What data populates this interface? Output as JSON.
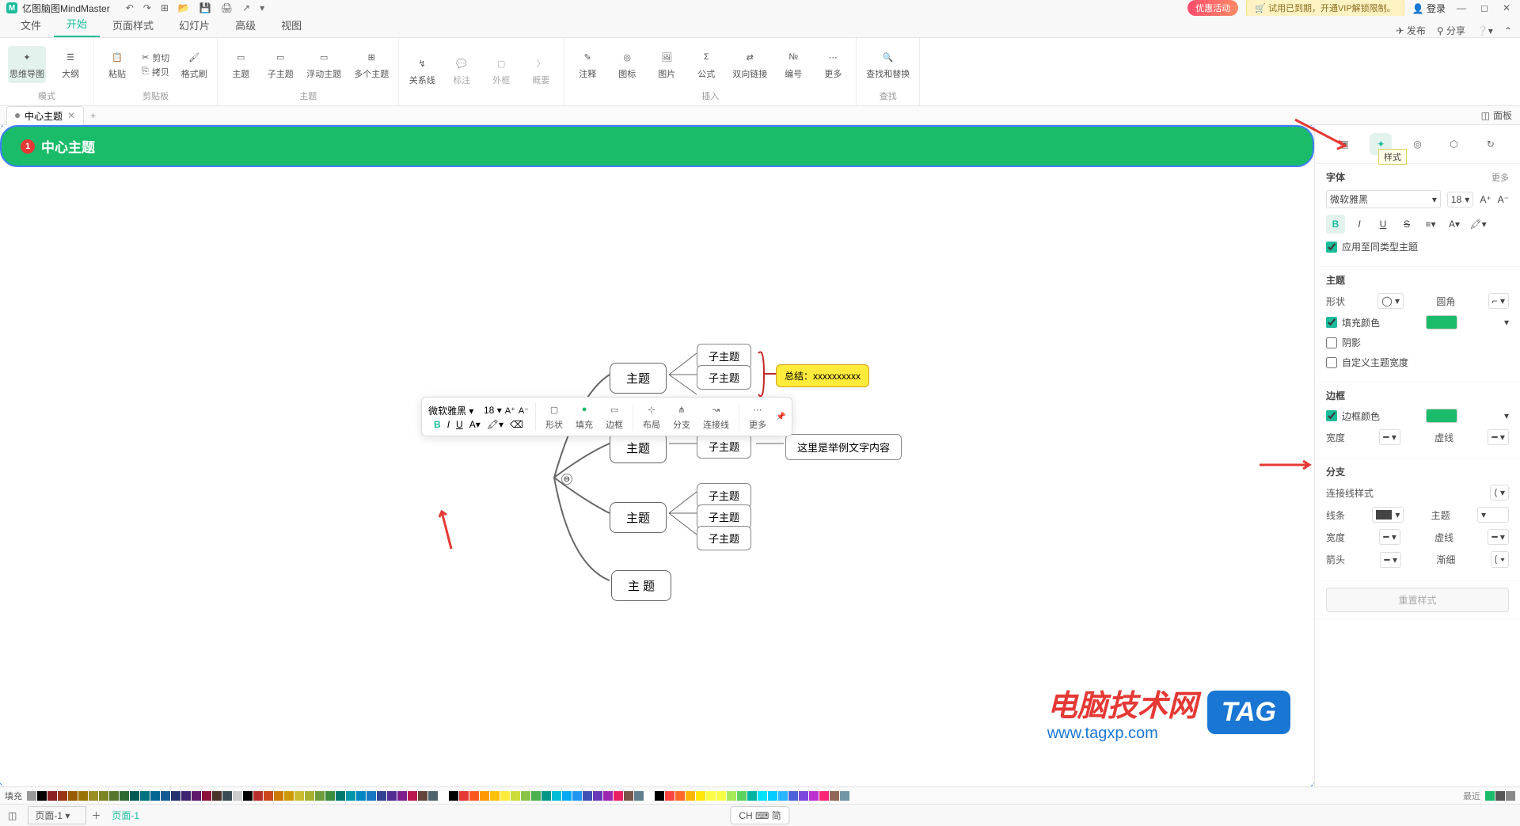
{
  "app": {
    "title": "亿图脑图MindMaster",
    "promo1": "优惠活动",
    "promo2": "🛒 试用已到期，开通VIP解锁限制。",
    "login": "👤 登录"
  },
  "menu": {
    "tabs": [
      "文件",
      "开始",
      "页面样式",
      "幻灯片",
      "高级",
      "视图"
    ],
    "active": 1,
    "publish": "发布",
    "share": "分享"
  },
  "ribbon": {
    "groups": {
      "mode": {
        "label": "模式",
        "items": [
          "思维导图",
          "大纲"
        ]
      },
      "clipboard": {
        "label": "剪贴板",
        "paste": "粘贴",
        "cut": "剪切",
        "copy": "拷贝",
        "format": "格式刷"
      },
      "topic": {
        "label": "主题",
        "items": [
          "主题",
          "子主题",
          "浮动主题",
          "多个主题"
        ]
      },
      "rel": {
        "label": "",
        "items": [
          "关系线",
          "标注",
          "外框",
          "概要"
        ]
      },
      "insert": {
        "label": "插入",
        "items": [
          "注释",
          "图标",
          "图片",
          "公式",
          "双向链接",
          "编号",
          "更多"
        ]
      },
      "find": {
        "label": "查找",
        "item": "查找和替换"
      }
    }
  },
  "doctab": {
    "name": "中心主题",
    "plus": "+"
  },
  "panel_toggle": "面板",
  "canvas": {
    "central": {
      "badge": "1",
      "label": "中心主题"
    },
    "topics": [
      "主题",
      "主题",
      "主题",
      "主 题"
    ],
    "subs": [
      "子主题",
      "子主题",
      "子主题",
      "子主题",
      "子主题",
      "子主题"
    ],
    "callout": "总结：xxxxxxxxxx",
    "example": "这里是举例文字内容"
  },
  "float": {
    "font": "微软雅黑",
    "size": "18",
    "groups": [
      "形状",
      "填充",
      "边框",
      "布局",
      "分支",
      "连接线",
      "更多"
    ]
  },
  "rpanel": {
    "tooltip": "样式",
    "font": {
      "title": "字体",
      "more": "更多",
      "family": "微软雅黑",
      "size": "18",
      "apply": "应用至同类型主题"
    },
    "theme": {
      "title": "主题",
      "shape": "形状",
      "corner": "圆角",
      "fill": "填充颜色",
      "shadow": "阴影",
      "customw": "自定义主题宽度"
    },
    "border": {
      "title": "边框",
      "color": "边框颜色",
      "width": "宽度",
      "dash": "虚线"
    },
    "branch": {
      "title": "分支",
      "connstyle": "连接线样式",
      "linecolor": "线条",
      "topic": "主题",
      "width": "宽度",
      "dash": "虚线",
      "arrow": "箭头",
      "taper": "渐细"
    },
    "reset": "重置样式"
  },
  "colorbar": {
    "label": "填充"
  },
  "status": {
    "page": "页面-1",
    "ptab": "页面-1",
    "ime": "CH ⌨ 简",
    "recent": "最近"
  },
  "watermark": {
    "txt": "电脑技术网",
    "url": "www.tagxp.com",
    "tag": "TAG"
  }
}
